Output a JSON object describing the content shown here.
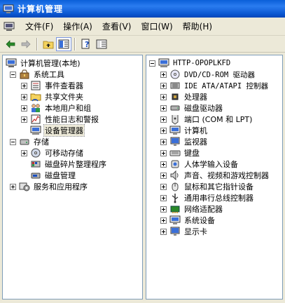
{
  "window": {
    "title": "计算机管理"
  },
  "menubar": {
    "items": [
      "文件(F)",
      "操作(A)",
      "查看(V)",
      "窗口(W)",
      "帮助(H)"
    ]
  },
  "toolbar": {
    "icons": [
      "back-arrow-icon",
      "forward-arrow-icon",
      "up-folder-icon",
      "show-hide-tree-icon",
      "help-icon",
      "properties-icon"
    ]
  },
  "left_tree": {
    "root": "计算机管理(本地)",
    "system_tools": "系统工具",
    "event_viewer": "事件查看器",
    "shared_folders": "共享文件夹",
    "local_users": "本地用户和组",
    "perf_logs": "性能日志和警报",
    "device_manager": "设备管理器",
    "storage": "存储",
    "removable_storage": "可移动存储",
    "defrag": "磁盘碎片整理程序",
    "disk_mgmt": "磁盘管理",
    "services_apps": "服务和应用程序"
  },
  "right_tree": {
    "root": "HTTP-OPOPLKFD",
    "devices": [
      "DVD/CD-ROM 驱动器",
      "IDE ATA/ATAPI 控制器",
      "处理器",
      "磁盘驱动器",
      "端口 (COM 和 LPT)",
      "计算机",
      "监视器",
      "键盘",
      "人体学输入设备",
      "声音、视频和游戏控制器",
      "鼠标和其它指针设备",
      "通用串行总线控制器",
      "网络适配器",
      "系统设备",
      "显示卡"
    ]
  }
}
